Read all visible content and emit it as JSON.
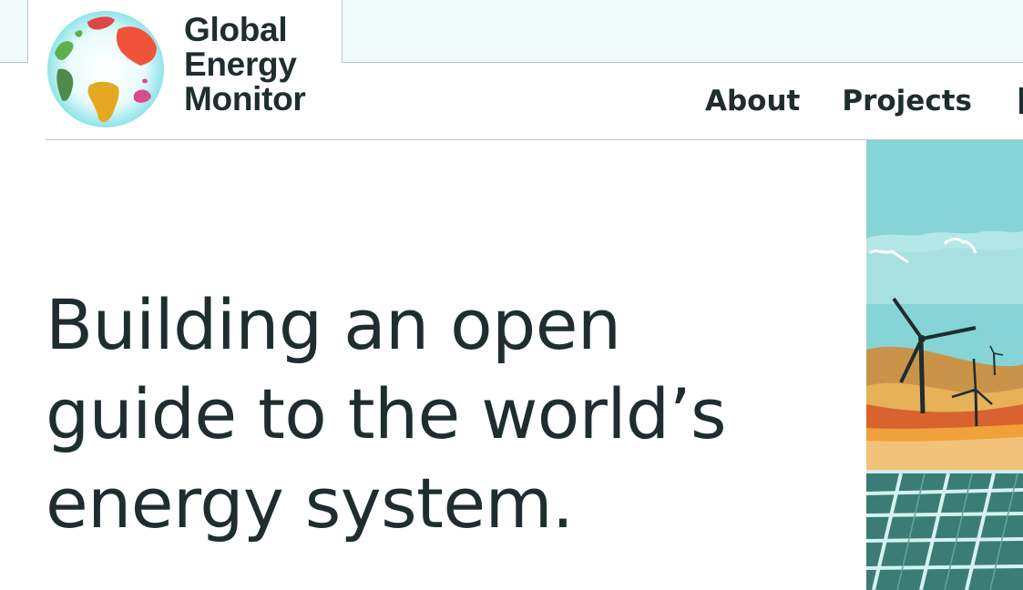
{
  "brand": {
    "name_line1": "Global",
    "name_line2": "Energy",
    "name_line3": "Monitor",
    "logo_icon": "globe-icon"
  },
  "nav": {
    "items": [
      {
        "label": "About"
      },
      {
        "label": "Projects"
      }
    ]
  },
  "hero": {
    "title_line1": "Building an open",
    "title_line2": "guide to the world’s",
    "title_line3": "energy system.",
    "illustration": "wind-solar-illustration"
  },
  "colors": {
    "text": "#1f2d2f",
    "top_strip": "#f2fbfb",
    "rule": "#b9c6c6",
    "sky": "#86d4d5",
    "panel": "#3b7d76"
  }
}
